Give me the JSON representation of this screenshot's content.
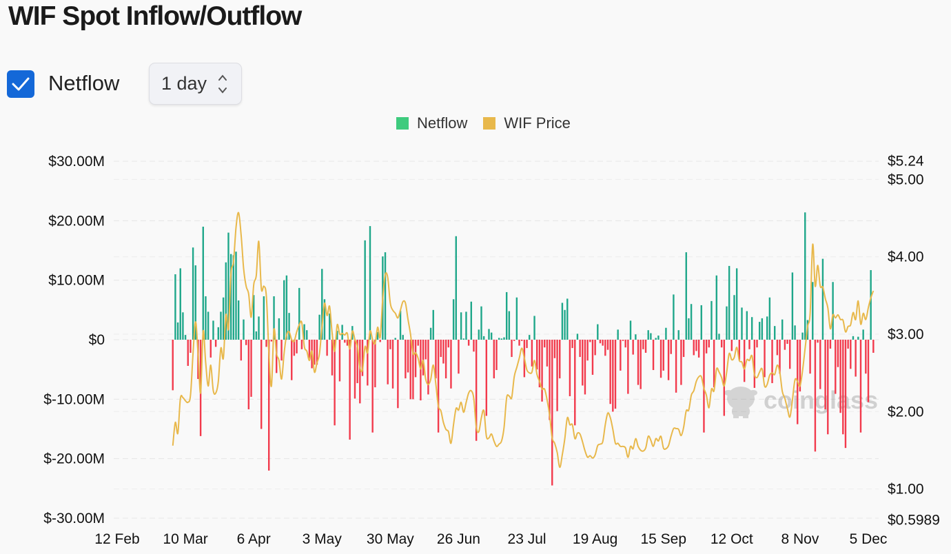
{
  "title": "WIF Spot Inflow/Outflow",
  "controls": {
    "netflow_checkbox_label": "Netflow",
    "netflow_checked": true,
    "interval_value": "1 day"
  },
  "legend": [
    {
      "label": "Netflow",
      "color": "#3ecb7e"
    },
    {
      "label": "WIF Price",
      "color": "#e8b84b"
    }
  ],
  "watermark": "coinglass",
  "colors": {
    "positive": "#1fa78a",
    "negative": "#f23a4c",
    "price": "#e8b84b",
    "checkbox": "#1468d8"
  },
  "chart_data": {
    "type": "bar+line",
    "interval": "1 day",
    "x_ticks": [
      "12 Feb",
      "10 Mar",
      "6 Apr",
      "3 May",
      "30 May",
      "26 Jun",
      "23 Jul",
      "19 Aug",
      "15 Sep",
      "12 Oct",
      "8 Nov",
      "5 Dec"
    ],
    "y_left_ticks": [
      "$30.00M",
      "$20.00M",
      "$10.00M",
      "$0",
      "$-10.00M",
      "$-20.00M",
      "$-30.00M"
    ],
    "y_left_range": [
      -30,
      30
    ],
    "y_left_unit": "USD millions",
    "y_right_ticks": [
      "$5.24",
      "$5.00",
      "$4.00",
      "$3.00",
      "$2.00",
      "$1.00",
      "$0.5989"
    ],
    "y_right_range": [
      0.5989,
      5.24
    ],
    "grid": "horizontal dashed",
    "legend_position": "top-center",
    "dates": [
      "5 Mar",
      "6 Mar",
      "7 Mar",
      "8 Mar",
      "9 Mar",
      "10 Mar",
      "11 Mar",
      "12 Mar",
      "13 Mar",
      "14 Mar",
      "15 Mar",
      "16 Mar",
      "17 Mar",
      "18 Mar",
      "19 Mar",
      "20 Mar",
      "21 Mar",
      "22 Mar",
      "23 Mar",
      "24 Mar",
      "25 Mar",
      "26 Mar",
      "27 Mar",
      "28 Mar",
      "29 Mar",
      "30 Mar",
      "31 Mar",
      "1 Apr",
      "2 Apr",
      "3 Apr",
      "4 Apr",
      "5 Apr",
      "6 Apr",
      "7 Apr",
      "8 Apr",
      "9 Apr",
      "10 Apr",
      "11 Apr",
      "12 Apr",
      "13 Apr",
      "14 Apr",
      "15 Apr",
      "16 Apr",
      "17 Apr",
      "18 Apr",
      "19 Apr",
      "20 Apr",
      "21 Apr",
      "22 Apr",
      "23 Apr",
      "24 Apr",
      "25 Apr",
      "26 Apr",
      "27 Apr",
      "28 Apr",
      "29 Apr",
      "30 Apr",
      "1 May",
      "2 May",
      "3 May",
      "4 May",
      "5 May",
      "6 May",
      "7 May",
      "8 May",
      "9 May",
      "10 May",
      "11 May",
      "12 May",
      "13 May",
      "14 May",
      "15 May",
      "16 May",
      "17 May",
      "18 May",
      "19 May",
      "20 May",
      "21 May",
      "22 May",
      "23 May",
      "24 May",
      "25 May",
      "26 May",
      "27 May",
      "28 May",
      "29 May",
      "30 May",
      "31 May",
      "1 Jun",
      "2 Jun",
      "3 Jun",
      "4 Jun",
      "5 Jun",
      "6 Jun",
      "7 Jun",
      "8 Jun",
      "9 Jun",
      "10 Jun",
      "11 Jun",
      "12 Jun",
      "13 Jun",
      "14 Jun",
      "15 Jun",
      "16 Jun",
      "17 Jun",
      "18 Jun",
      "19 Jun",
      "20 Jun",
      "21 Jun",
      "22 Jun",
      "23 Jun",
      "24 Jun",
      "25 Jun",
      "26 Jun",
      "27 Jun",
      "28 Jun",
      "29 Jun",
      "30 Jun",
      "1 Jul",
      "2 Jul",
      "3 Jul",
      "4 Jul",
      "5 Jul",
      "6 Jul",
      "7 Jul",
      "8 Jul",
      "9 Jul",
      "10 Jul",
      "11 Jul",
      "12 Jul",
      "13 Jul",
      "14 Jul",
      "15 Jul",
      "16 Jul",
      "17 Jul",
      "18 Jul",
      "19 Jul",
      "20 Jul",
      "21 Jul",
      "22 Jul",
      "23 Jul",
      "24 Jul",
      "25 Jul",
      "26 Jul",
      "27 Jul",
      "28 Jul",
      "29 Jul",
      "30 Jul",
      "31 Jul",
      "1 Aug",
      "2 Aug",
      "3 Aug",
      "4 Aug",
      "5 Aug",
      "6 Aug",
      "7 Aug",
      "8 Aug",
      "9 Aug",
      "10 Aug",
      "11 Aug",
      "12 Aug",
      "13 Aug",
      "14 Aug",
      "15 Aug",
      "16 Aug",
      "17 Aug",
      "18 Aug",
      "19 Aug",
      "20 Aug",
      "21 Aug",
      "22 Aug",
      "23 Aug",
      "24 Aug",
      "25 Aug",
      "26 Aug",
      "27 Aug",
      "28 Aug",
      "29 Aug",
      "30 Aug",
      "31 Aug",
      "1 Sep",
      "2 Sep",
      "3 Sep",
      "4 Sep",
      "5 Sep",
      "6 Sep",
      "7 Sep",
      "8 Sep",
      "9 Sep",
      "10 Sep",
      "11 Sep",
      "12 Sep",
      "13 Sep",
      "14 Sep",
      "15 Sep",
      "16 Sep",
      "17 Sep",
      "18 Sep",
      "19 Sep",
      "20 Sep",
      "21 Sep",
      "22 Sep",
      "23 Sep",
      "24 Sep",
      "25 Sep",
      "26 Sep",
      "27 Sep",
      "28 Sep",
      "29 Sep",
      "30 Sep",
      "1 Oct",
      "2 Oct",
      "3 Oct",
      "4 Oct",
      "5 Oct",
      "6 Oct",
      "7 Oct",
      "8 Oct",
      "9 Oct",
      "10 Oct",
      "11 Oct",
      "12 Oct",
      "13 Oct",
      "14 Oct",
      "15 Oct",
      "16 Oct",
      "17 Oct",
      "18 Oct",
      "19 Oct",
      "20 Oct",
      "21 Oct",
      "22 Oct",
      "23 Oct",
      "24 Oct",
      "25 Oct",
      "26 Oct",
      "27 Oct",
      "28 Oct",
      "29 Oct",
      "30 Oct",
      "31 Oct",
      "1 Nov",
      "2 Nov",
      "3 Nov",
      "4 Nov",
      "5 Nov",
      "6 Nov",
      "7 Nov",
      "8 Nov",
      "9 Nov",
      "10 Nov",
      "11 Nov",
      "12 Nov",
      "13 Nov",
      "14 Nov",
      "15 Nov",
      "16 Nov",
      "17 Nov",
      "18 Nov",
      "19 Nov",
      "20 Nov",
      "21 Nov",
      "22 Nov",
      "23 Nov",
      "24 Nov",
      "25 Nov",
      "26 Nov",
      "27 Nov",
      "28 Nov",
      "29 Nov",
      "30 Nov",
      "1 Dec",
      "2 Dec",
      "3 Dec",
      "4 Dec",
      "5 Dec",
      "6 Dec",
      "7 Dec"
    ],
    "series": [
      {
        "name": "Netflow",
        "type": "bar",
        "axis": "left",
        "values": [
          -8.5,
          11,
          2.9,
          12,
          4.6,
          0.8,
          -4.4,
          -2.2,
          15.5,
          12.5,
          -6.6,
          -16.2,
          19,
          7.3,
          4.7,
          -3,
          3.2,
          -1.2,
          2.1,
          4.7,
          7.1,
          13,
          18,
          14.4,
          14.2,
          14.8,
          6.6,
          -3.5,
          3.4,
          -0.9,
          -11.7,
          -9.6,
          7.5,
          1.4,
          3.9,
          -15,
          7.3,
          -1.2,
          -22,
          -0.3,
          7.3,
          -5.6,
          3.6,
          -3.5,
          10,
          10.8,
          4.5,
          -6.8,
          -2.7,
          -2.3,
          8.7,
          -1.6,
          2.6,
          1.6,
          -3.1,
          -4.8,
          -4.2,
          -4.2,
          4.2,
          11.9,
          6.8,
          -2.7,
          4.4,
          -6,
          -14.4,
          1.5,
          -7,
          2.5,
          -0.5,
          -1,
          -16.8,
          2.3,
          -9.9,
          -7.3,
          -10.7,
          -6.1,
          16.7,
          -7.7,
          19.1,
          -15.6,
          -8,
          1.3,
          -0.4,
          14,
          14.7,
          -7.5,
          -1.6,
          -8.2,
          0.3,
          -11.5,
          4.9,
          0.8,
          -6.5,
          -5.5,
          -10,
          -10,
          -6.3,
          -1,
          -10.2,
          -6,
          -3.3,
          -9.2,
          2,
          5,
          -6.5,
          -15.6,
          -2.9,
          -4,
          -6.5,
          -1.3,
          -8.2,
          6.8,
          17.4,
          -5.7,
          4.6,
          0.2,
          4.7,
          -1,
          6.4,
          -2,
          -17,
          1.7,
          5.6,
          0.6,
          -12.8,
          1.8,
          1.2,
          -6.5,
          -5.1,
          0.3,
          0.2,
          0.4,
          8,
          4.8,
          -2.9,
          -0.2,
          7.1,
          -1,
          -0.2,
          -6.3,
          -1.4,
          0.8,
          -4.5,
          4,
          -5,
          -8,
          -10.4,
          -1.3,
          -4.5,
          -13.5,
          -24.5,
          -3.1,
          -12,
          -6.5,
          6.2,
          5,
          6.9,
          -9.5,
          -1.4,
          -14.4,
          1,
          -2.9,
          -7.7,
          -9.2,
          -3.5,
          -0.4,
          -5.9,
          -2.6,
          2.6,
          -0.6,
          -1,
          -2.7,
          -1.7,
          -10.8,
          -12.1,
          -11.6,
          1.7,
          -5.2,
          -0.2,
          -1.3,
          -9.1,
          3.2,
          -2.5,
          0.9,
          -7.6,
          -8.3,
          -1.6,
          -2.2,
          1.6,
          1.1,
          -5.1,
          0.3,
          0.7,
          -6.4,
          -5.2,
          2,
          -6.8,
          -2.4,
          7.6,
          -8.9,
          1.6,
          -7.6,
          -2.9,
          14.7,
          3.6,
          6,
          -2.6,
          -1.9,
          -3,
          5.8,
          -15.6,
          -2.3,
          -1.3,
          6.5,
          -8,
          10.8,
          1,
          -1.3,
          -12.8,
          5.6,
          12.4,
          -1.9,
          7.5,
          12,
          -3.4,
          5.4,
          -7.1,
          4.8,
          -1.6,
          3.8,
          -8.1,
          -1.3,
          3,
          3.6,
          -6.3,
          3.9,
          7.1,
          -7.3,
          2.3,
          -2.6,
          -5.7,
          3.4,
          -1.7,
          -0.7,
          -4.9,
          11.3,
          2.4,
          -14.2,
          -8.7,
          1.2,
          21.4,
          3.3,
          -5.7,
          9.7,
          -18.8,
          -0.5,
          -8.3,
          13.6,
          -11.7,
          -15.9,
          -1.5,
          9.7,
          -9.1,
          -4.6,
          -12.3,
          -15.9,
          -18.2,
          -1.5,
          -4.9,
          0.6,
          -6.2,
          0.5,
          -15.6,
          1.7,
          -5.7,
          -10.5,
          11.7,
          -2.2
        ]
      },
      {
        "name": "WIF Price",
        "type": "line",
        "axis": "right",
        "values": [
          1.56,
          1.86,
          1.72,
          2.17,
          2.18,
          2.14,
          2.12,
          2.21,
          2.75,
          3.16,
          2.75,
          2.24,
          3.04,
          2.63,
          2.33,
          2.6,
          2.27,
          2.24,
          2.39,
          2.82,
          2.69,
          3.25,
          3.07,
          3.79,
          3.93,
          4.38,
          4.57,
          4.29,
          3.85,
          3.62,
          3.52,
          3.22,
          3.64,
          3.76,
          4.2,
          3.59,
          3.62,
          3.49,
          2.75,
          2.33,
          3.06,
          2.75,
          2.66,
          2.42,
          2.75,
          2.99,
          3.03,
          2.93,
          2.91,
          3.03,
          3.12,
          3.15,
          2.84,
          2.78,
          2.66,
          2.78,
          2.51,
          2.63,
          2.75,
          3.1,
          3.4,
          3.24,
          3.36,
          3.01,
          2.78,
          3.12,
          3.0,
          3.01,
          2.99,
          3.01,
          2.81,
          3.04,
          2.93,
          2.84,
          2.57,
          2.54,
          2.84,
          2.76,
          3.04,
          2.93,
          2.88,
          3.09,
          2.96,
          3.46,
          3.77,
          3.73,
          3.4,
          3.31,
          3.27,
          3.21,
          3.31,
          3.42,
          3.4,
          3.19,
          3.0,
          2.75,
          2.76,
          2.69,
          2.55,
          2.66,
          2.42,
          2.35,
          2.42,
          2.6,
          2.36,
          2.07,
          2.01,
          1.86,
          1.77,
          1.74,
          1.59,
          1.83,
          2.04,
          2.02,
          2.12,
          1.99,
          2.12,
          2.24,
          2.27,
          2.17,
          1.8,
          1.74,
          1.92,
          2.01,
          1.68,
          1.66,
          1.71,
          1.62,
          1.55,
          1.58,
          1.62,
          1.8,
          2.18,
          2.2,
          2.18,
          2.45,
          2.57,
          2.69,
          2.82,
          2.69,
          2.54,
          2.5,
          2.51,
          2.66,
          2.48,
          2.39,
          2.29,
          2.29,
          2.15,
          1.95,
          1.66,
          1.59,
          1.47,
          1.28,
          1.44,
          1.65,
          1.92,
          1.83,
          1.83,
          1.65,
          1.72,
          1.71,
          1.61,
          1.49,
          1.41,
          1.43,
          1.4,
          1.44,
          1.56,
          1.58,
          1.61,
          1.83,
          1.98,
          1.92,
          1.77,
          1.59,
          1.59,
          1.55,
          1.55,
          1.53,
          1.41,
          1.55,
          1.52,
          1.65,
          1.55,
          1.5,
          1.49,
          1.53,
          1.68,
          1.63,
          1.55,
          1.65,
          1.62,
          1.68,
          1.53,
          1.52,
          1.56,
          1.68,
          1.78,
          1.78,
          1.77,
          1.69,
          1.8,
          2.01,
          2.02,
          2.21,
          2.27,
          2.39,
          2.45,
          2.45,
          2.3,
          2.21,
          2.05,
          2.29,
          2.27,
          2.55,
          2.51,
          2.44,
          2.33,
          2.51,
          2.75,
          2.67,
          2.7,
          2.83,
          2.66,
          2.64,
          2.55,
          2.67,
          2.66,
          2.72,
          2.48,
          2.44,
          2.51,
          2.55,
          2.33,
          2.35,
          2.47,
          2.5,
          2.48,
          2.6,
          2.51,
          2.26,
          2.17,
          2.04,
          1.93,
          2.15,
          2.41,
          2.39,
          2.33,
          2.53,
          2.81,
          3.1,
          3.27,
          4.16,
          3.62,
          3.89,
          3.62,
          3.61,
          3.46,
          3.34,
          3.07,
          3.25,
          3.21,
          3.25,
          3.19,
          3.18,
          3.03,
          3.1,
          3.12,
          3.28,
          3.19,
          3.43,
          3.13,
          3.27,
          3.19,
          3.34,
          3.47,
          3.56
        ]
      }
    ]
  }
}
